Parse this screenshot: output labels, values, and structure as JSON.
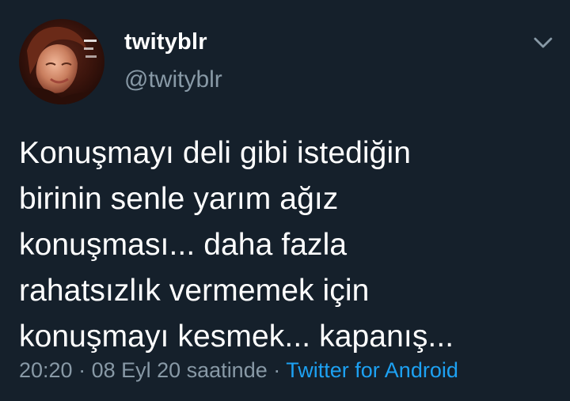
{
  "user": {
    "display_name": "twityblr",
    "handle": "@twityblr"
  },
  "tweet": {
    "lines": [
      "Konuşmayı deli gibi istediğin",
      "birinin senle yarım ağız",
      "konuşması... daha fazla",
      "rahatsızlık vermemek için",
      "konuşmayı kesmek... kapanış..."
    ]
  },
  "meta": {
    "time": "20:20",
    "separator1": " · ",
    "date": "08 Eyl 20 saatinde",
    "separator2": " · ",
    "source": "Twitter for Android"
  },
  "icons": {
    "more": "chevron-down-icon",
    "avatar": "profile-photo"
  },
  "colors": {
    "background": "#15202b",
    "primary_text": "#ffffff",
    "secondary_text": "#8899a6",
    "link": "#1da1f2"
  }
}
